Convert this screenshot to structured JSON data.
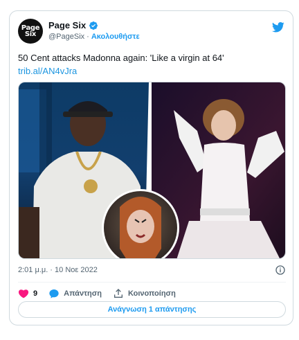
{
  "author": {
    "avatar_line1": "Page",
    "avatar_line2": "Six",
    "display_name": "Page Six",
    "handle": "@PageSix",
    "separator": "·",
    "follow_label": "Ακολουθήστε"
  },
  "tweet": {
    "text": "50 Cent attacks Madonna again: 'Like a virgin at 64'",
    "link": "trib.al/AN4vJra",
    "timestamp": "2:01 μ.μ. · 10 Νοε 2022"
  },
  "actions": {
    "like_count": "9",
    "reply_label": "Απάντηση",
    "share_label": "Κοινοποίηση"
  },
  "read_replies_label": "Ανάγνωση 1 απάντησης",
  "colors": {
    "accent": "#1d9bf0",
    "like": "#f91880",
    "text_secondary": "#536471",
    "border": "#cfd9de"
  },
  "icons": {
    "verified": "verified-badge-icon",
    "twitter": "twitter-bird-icon",
    "info": "info-icon",
    "like": "heart-icon",
    "reply": "speech-bubble-icon",
    "share": "share-icon"
  }
}
